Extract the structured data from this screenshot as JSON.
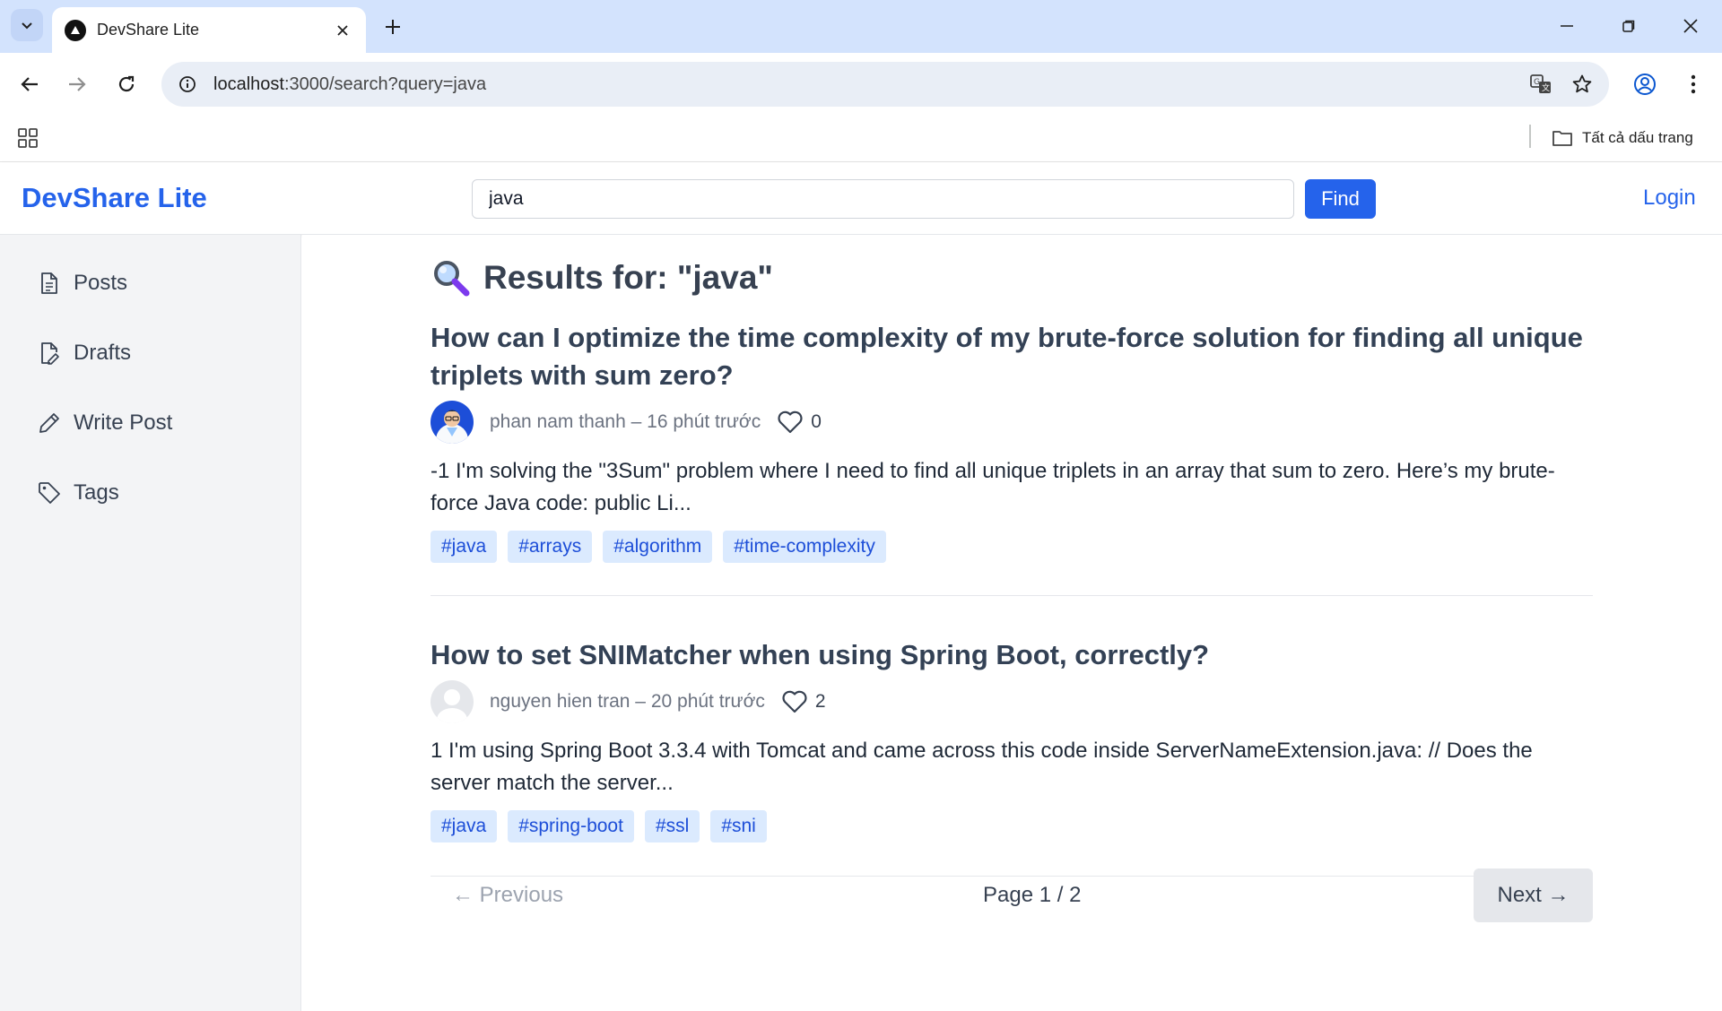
{
  "browser": {
    "tab_title": "DevShare Lite",
    "url_host": "localhost",
    "url_path": ":3000/search?query=java",
    "bookmarks_label": "Tất cả dấu trang"
  },
  "header": {
    "brand": "DevShare Lite",
    "search_value": "java",
    "search_placeholder": "",
    "find_label": "Find",
    "login_label": "Login"
  },
  "sidebar": {
    "items": [
      {
        "label": "Posts",
        "icon": "file-text-icon"
      },
      {
        "label": "Drafts",
        "icon": "file-edit-icon"
      },
      {
        "label": "Write Post",
        "icon": "pencil-icon"
      },
      {
        "label": "Tags",
        "icon": "tag-icon"
      }
    ]
  },
  "main": {
    "heading": "Results for: \"java\"",
    "posts": [
      {
        "title": "How can I optimize the time complexity of my brute-force solution for finding all unique triplets with sum zero?",
        "author": "phan nam thanh",
        "time": " – 16 phút trước",
        "likes": "0",
        "excerpt": "-1 I'm solving the \"3Sum\" problem where I need to find all unique triplets in an array that sum to zero. Here’s my brute-force Java code: public Li...",
        "tags": [
          "#java",
          "#arrays",
          "#algorithm",
          "#time-complexity"
        ]
      },
      {
        "title": "How to set SNIMatcher when using Spring Boot, correctly?",
        "author": "nguyen hien tran",
        "time": " – 20 phút trước",
        "likes": "2",
        "excerpt": "1 I'm using Spring Boot 3.3.4 with Tomcat and came across this code inside ServerNameExtension.java: // Does the server match the server...",
        "tags": [
          "#java",
          "#spring-boot",
          "#ssl",
          "#sni"
        ]
      }
    ],
    "pagination": {
      "prev_label": "← Previous",
      "page_info": "Page 1 / 2",
      "next_label": "Next →"
    }
  },
  "colors": {
    "accent": "#2563eb",
    "tag_bg": "#dbeafe",
    "tag_text": "#1d4ed8",
    "sidebar_bg": "#f3f4f6"
  }
}
